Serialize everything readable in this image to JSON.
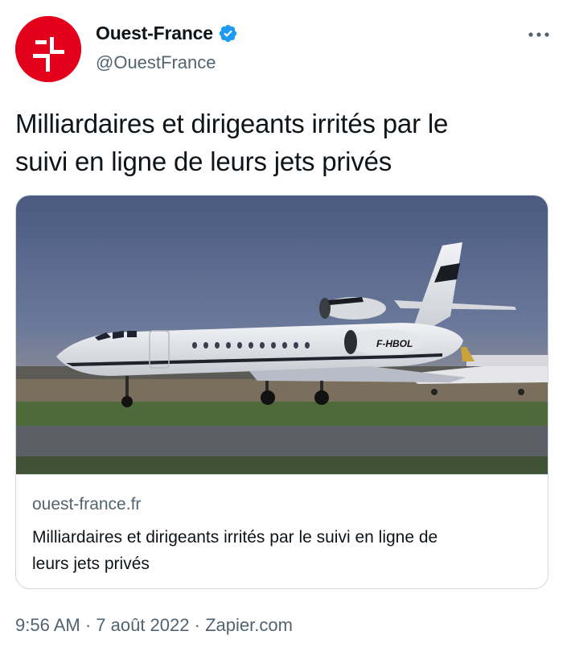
{
  "account": {
    "display_name": "Ouest-France",
    "handle": "@OuestFrance",
    "avatar_icon": "ouest-france-logo-icon",
    "verified_icon": "verified-badge-icon",
    "brand_color": "#e2001a",
    "verified_color": "#1d9bf0"
  },
  "tweet": {
    "text_line1": "Milliardaires et dirigeants irrités par le",
    "text_line2": "suivi en ligne de leurs jets privés"
  },
  "card": {
    "image_description_icon": "private-jet-photo",
    "jet_registration": "F-HBOL",
    "domain": "ouest-france.fr",
    "title_line1": "Milliardaires et dirigeants irrités par le suivi en ligne de",
    "title_line2": "leurs jets privés"
  },
  "footer": {
    "time": "9:56 AM",
    "sep1": " · ",
    "date": "7 août 2022",
    "sep2": " · ",
    "source": "Zapier.com"
  },
  "more_icon": "more-options-icon"
}
